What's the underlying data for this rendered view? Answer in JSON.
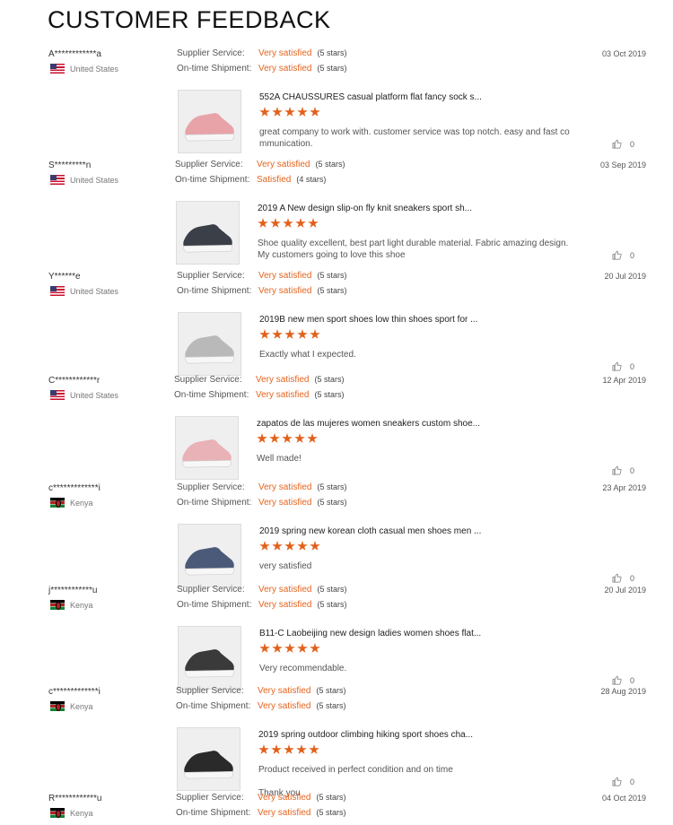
{
  "page_title": "CUSTOMER FEEDBACK",
  "labels": {
    "supplier": "Supplier Service:",
    "shipment": "On-time Shipment:"
  },
  "colors": {
    "accent": "#e6641e",
    "star": "#e2601a"
  },
  "reviews": [
    {
      "user": "A************a",
      "country": "United States",
      "flag": "us",
      "supplier_value": "Very satisfied",
      "supplier_stars": "(5 stars)",
      "shipment_value": "Very satisfied",
      "shipment_stars": "(5 stars)",
      "date": "03 Oct 2019",
      "product": "552A CHAUSSURES casual platform flat fancy sock s...",
      "rating": 5,
      "comment": "great company to work with. customer service was top notch. easy and fast co mmunication.",
      "likes": "0",
      "thumb_color": "#e8a3a8"
    },
    {
      "user": "S*********n",
      "country": "United States",
      "flag": "us",
      "supplier_value": "Very satisfied",
      "supplier_stars": "(5 stars)",
      "shipment_value": "Satisfied",
      "shipment_stars": "(4 stars)",
      "date": "03 Sep 2019",
      "product": "2019 A New design slip-on fly knit sneakers sport sh...",
      "rating": 5,
      "comment": "Shoe quality excellent, best part light durable material. Fabric amazing design. My customers going to love this shoe",
      "likes": "0",
      "thumb_color": "#3a3f48"
    },
    {
      "user": "Y******e",
      "country": "United States",
      "flag": "us",
      "supplier_value": "Very satisfied",
      "supplier_stars": "(5 stars)",
      "shipment_value": "Very satisfied",
      "shipment_stars": "(5 stars)",
      "date": "20 Jul 2019",
      "product": "2019B new men sport shoes low thin shoes sport for ...",
      "rating": 5,
      "comment": "Exactly what I expected.",
      "likes": "0",
      "thumb_color": "#b9b9b9"
    },
    {
      "user": "C************r",
      "country": "United States",
      "flag": "us",
      "supplier_value": "Very satisfied",
      "supplier_stars": "(5 stars)",
      "shipment_value": "Very satisfied",
      "shipment_stars": "(5 stars)",
      "date": "12 Apr 2019",
      "product": "zapatos de las mujeres women sneakers custom shoe...",
      "rating": 5,
      "comment": "Well made!",
      "likes": "0",
      "thumb_color": "#e8b2b6"
    },
    {
      "user": "c*************i",
      "country": "Kenya",
      "flag": "ke",
      "supplier_value": "Very satisfied",
      "supplier_stars": "(5 stars)",
      "shipment_value": "Very satisfied",
      "shipment_stars": "(5 stars)",
      "date": "23 Apr 2019",
      "product": "2019 spring new korean cloth casual men shoes men ...",
      "rating": 5,
      "comment": "very satisfied",
      "likes": "0",
      "thumb_color": "#4b5a78"
    },
    {
      "user": "j************u",
      "country": "Kenya",
      "flag": "ke",
      "supplier_value": "Very satisfied",
      "supplier_stars": "(5 stars)",
      "shipment_value": "Very satisfied",
      "shipment_stars": "(5 stars)",
      "date": "20 Jul 2019",
      "product": "B11-C Laobeijing new design ladies women shoes flat...",
      "rating": 5,
      "comment": "Very recommendable.",
      "likes": "0",
      "thumb_color": "#3a3a3a"
    },
    {
      "user": "c*************i",
      "country": "Kenya",
      "flag": "ke",
      "supplier_value": "Very satisfied",
      "supplier_stars": "(5 stars)",
      "shipment_value": "Very satisfied",
      "shipment_stars": "(5 stars)",
      "date": "28 Aug 2019",
      "product": "2019 spring outdoor climbing hiking sport shoes cha...",
      "rating": 5,
      "comment": "Product received in perfect condition and on time\n\nThank you",
      "likes": "0",
      "thumb_color": "#2a2a2a"
    },
    {
      "user": "R************u",
      "country": "Kenya",
      "flag": "ke",
      "supplier_value": "Very satisfied",
      "supplier_stars": "(5 stars)",
      "shipment_value": "Very satisfied",
      "shipment_stars": "(5 stars)",
      "date": "04 Oct 2019"
    }
  ]
}
